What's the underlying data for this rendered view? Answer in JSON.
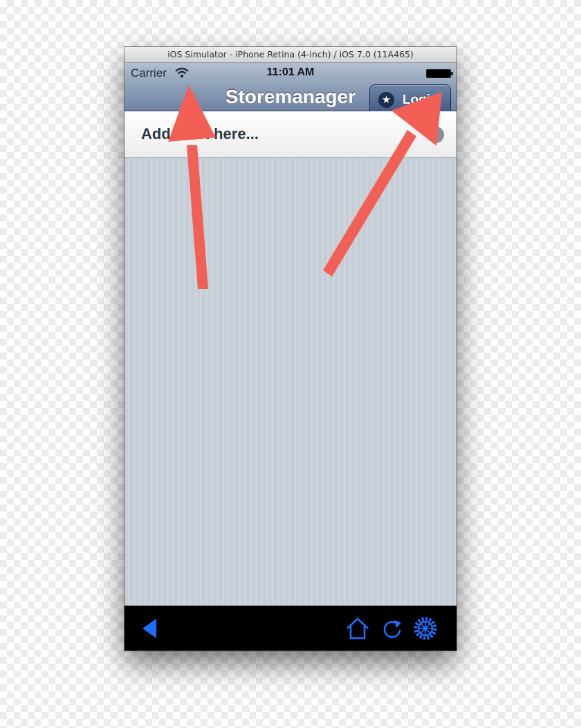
{
  "window": {
    "title": "iOS Simulator - iPhone Retina (4-inch) / iOS 7.0 (11A465)"
  },
  "status_bar": {
    "carrier": "Carrier",
    "time": "11:01 AM"
  },
  "nav_bar": {
    "title": "Storemanager",
    "login_label": "Login"
  },
  "list": {
    "add_row_label": "Add a list here..."
  },
  "toolbar": {
    "icons": [
      "back-icon",
      "home-icon",
      "refresh-icon",
      "gear-icon"
    ]
  },
  "colors": {
    "annotation_arrow": "#f25f55",
    "toolbar_icon": "#1e6fff",
    "nav_bar": "#8b9cb5",
    "content_background": "#c8d0d8"
  }
}
